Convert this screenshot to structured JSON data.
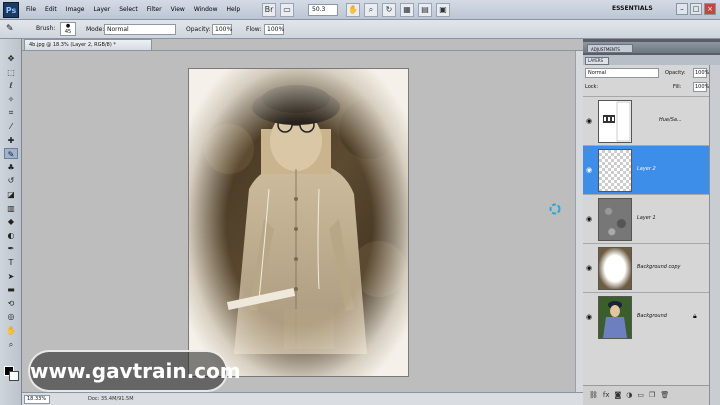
{
  "app": {
    "logo": "Ps"
  },
  "menu": [
    "File",
    "Edit",
    "Image",
    "Layer",
    "Select",
    "Filter",
    "View",
    "Window",
    "Help"
  ],
  "menubar": {
    "zoom": "50.3",
    "workspace": "ESSENTIALS"
  },
  "options": {
    "brush_label": "Brush:",
    "brush_size": "45",
    "mode_label": "Mode:",
    "mode_value": "Normal",
    "opacity_label": "Opacity:",
    "opacity_value": "100%",
    "flow_label": "Flow:",
    "flow_value": "100%"
  },
  "document": {
    "tab_title": "4b.jpg @ 18.3% (Layer 2, RGB/8) *",
    "zoom_status": "18.33%",
    "doc_info": "Doc: 35.4M/91.5M"
  },
  "watermark": "www.gavtrain.com",
  "panels": {
    "adjustments_tab": "ADJUSTMENTS",
    "layers_tab": "LAYERS",
    "blend_mode": "Normal",
    "opacity_label": "Opacity:",
    "opacity_value": "100%",
    "lock_label": "Lock:",
    "fill_label": "Fill:",
    "fill_value": "100%"
  },
  "layers": [
    {
      "name": "Hue/Sa...",
      "thumb": "adjustment",
      "selected": false
    },
    {
      "name": "Layer 2",
      "thumb": "transparent",
      "selected": true
    },
    {
      "name": "Layer 1",
      "thumb": "noise",
      "selected": false
    },
    {
      "name": "Background copy",
      "thumb": "masked",
      "selected": false
    },
    {
      "name": "Background",
      "thumb": "color-photo",
      "selected": false,
      "locked": true
    }
  ],
  "colors": {
    "selection": "#3d8ee8",
    "sepia_dark": "#4a3a24",
    "sepia_light": "#c9b48e"
  }
}
